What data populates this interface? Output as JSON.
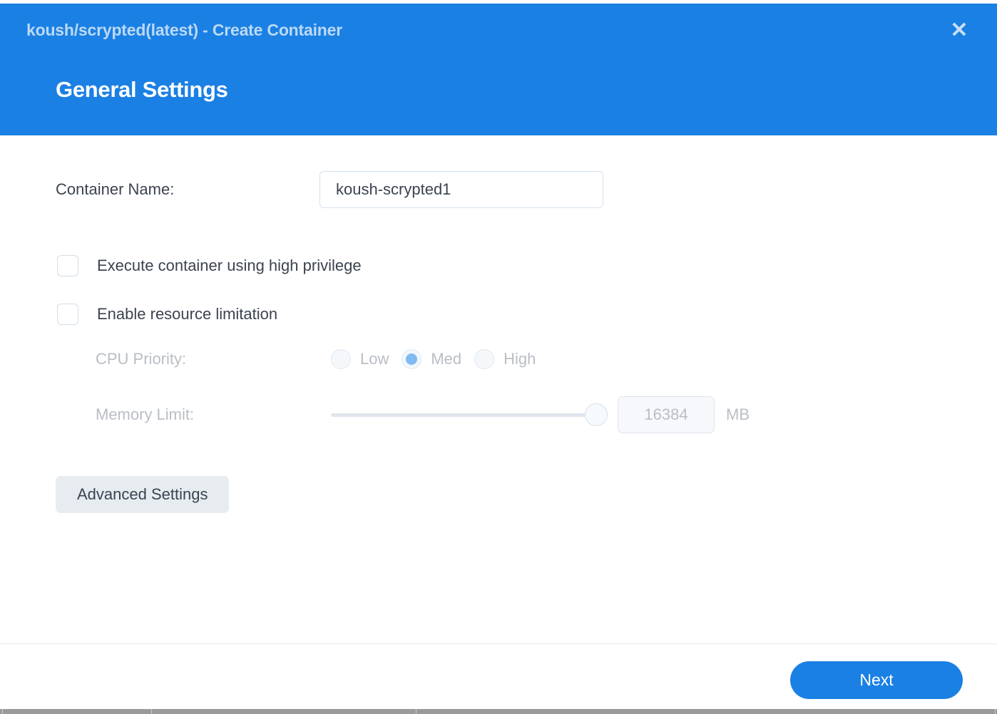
{
  "window": {
    "title": "koush/scrypted(latest) - Create Container",
    "close_label": "✕",
    "page_title": "General Settings",
    "accent_color": "#1a80e4",
    "title_text_color": "#bcd9f5"
  },
  "form": {
    "container_name": {
      "label": "Container Name:",
      "value": "koush-scrypted1",
      "placeholder": ""
    },
    "high_privilege": {
      "label": "Execute container using high privilege",
      "checked": false
    },
    "resource_limitation": {
      "label": "Enable resource limitation",
      "checked": false
    },
    "cpu_priority": {
      "label": "CPU Priority:",
      "selected": "Med",
      "options": [
        "Low",
        "Med",
        "High"
      ],
      "enabled": false
    },
    "memory_limit": {
      "label": "Memory Limit:",
      "value": "16384",
      "unit": "MB",
      "slider_percent": 100,
      "enabled": false
    },
    "advanced_settings_label": "Advanced Settings"
  },
  "footer": {
    "next_label": "Next"
  }
}
